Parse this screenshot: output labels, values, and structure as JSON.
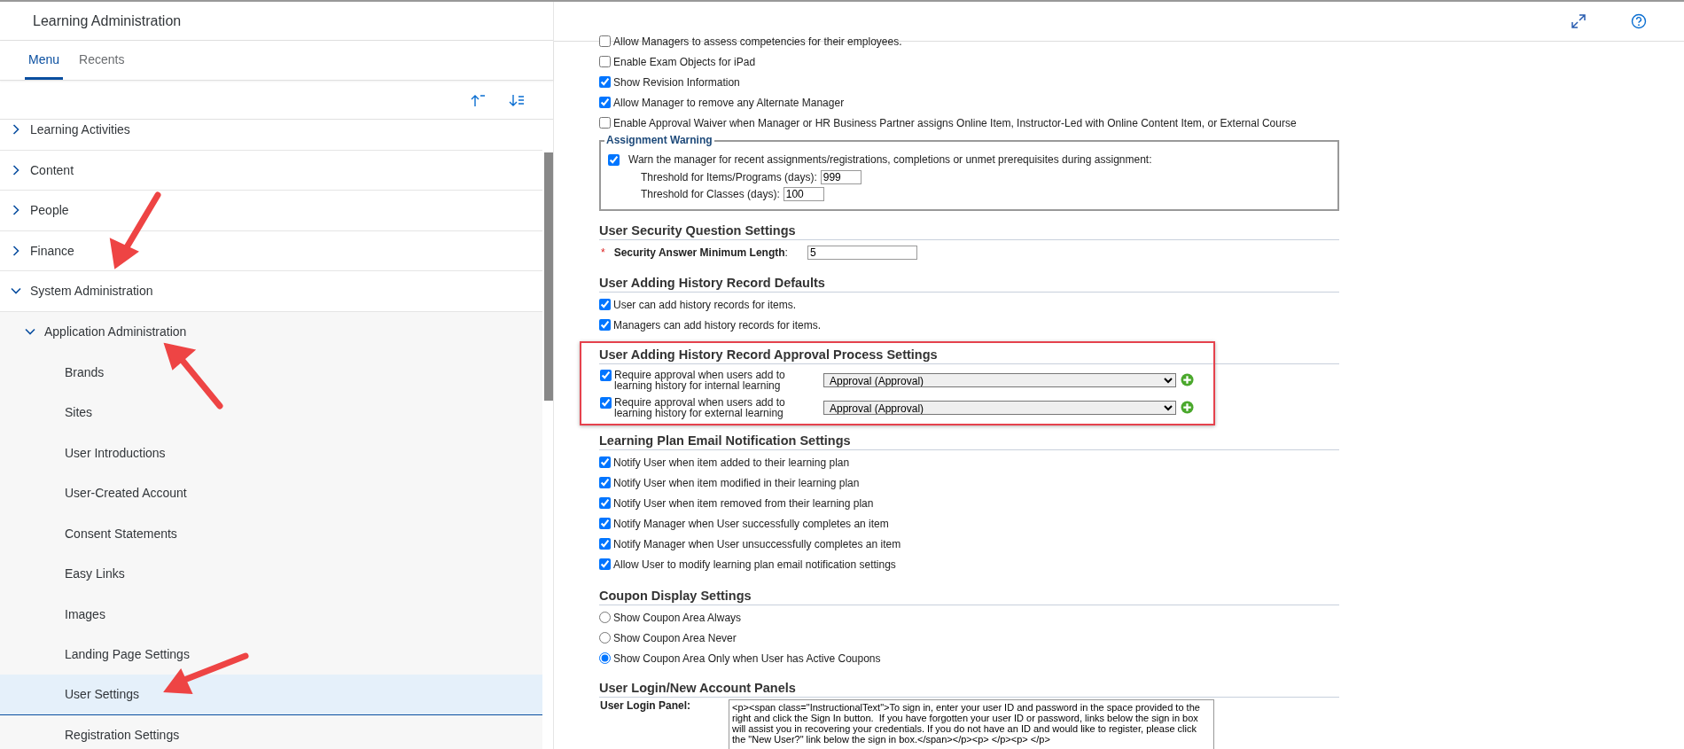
{
  "app_title": "Learning Administration",
  "tabs": [
    {
      "label": "Menu",
      "selected": true
    },
    {
      "label": "Recents",
      "selected": false
    }
  ],
  "menu": [
    {
      "label": "Learning Activities",
      "expanded": false,
      "selected": false
    },
    {
      "label": "Content",
      "expanded": false,
      "selected": false
    },
    {
      "label": "People",
      "expanded": false,
      "selected": false
    },
    {
      "label": "Finance",
      "expanded": false,
      "selected": false
    },
    {
      "label": "System Administration",
      "expanded": true,
      "selected": false,
      "children": [
        {
          "label": "Application Administration",
          "expanded": true,
          "selected": false,
          "children": [
            {
              "label": "Brands",
              "selected": false
            },
            {
              "label": "Sites",
              "selected": false
            },
            {
              "label": "User Introductions",
              "selected": false
            },
            {
              "label": "User-Created Account",
              "selected": false
            },
            {
              "label": "Consent Statements",
              "selected": false
            },
            {
              "label": "Easy Links",
              "selected": false
            },
            {
              "label": "Images",
              "selected": false
            },
            {
              "label": "Landing Page Settings",
              "selected": false
            },
            {
              "label": "User Settings",
              "selected": true
            },
            {
              "label": "Registration Settings",
              "selected": false
            }
          ]
        }
      ]
    }
  ],
  "sections": [
    {
      "kind": "checkboxes",
      "items": [
        {
          "label": "Allow Managers to assess competencies for their employees.",
          "checked": false
        },
        {
          "label": "Enable Exam Objects for iPad",
          "checked": false
        },
        {
          "label": "Show Revision Information",
          "checked": true
        },
        {
          "label": "Allow Manager to remove any Alternate Manager",
          "checked": true
        },
        {
          "label": "Enable Approval Waiver when Manager or HR Business Partner assigns Online Item, Instructor-Led with Online Content Item, or External Course",
          "checked": false
        }
      ]
    },
    {
      "kind": "fieldset",
      "title": "Assignment Warning",
      "checkbox": {
        "label": "Warn the manager for recent assignments/registrations, completions or unmet prerequisites during assignment:",
        "checked": true
      },
      "fields": [
        {
          "label": "Threshold for Items/Programs (days):",
          "value": "999"
        },
        {
          "label": "Threshold for Classes (days):",
          "value": "100"
        }
      ]
    },
    {
      "kind": "fields",
      "title": "User Security Question Settings",
      "items": [
        {
          "required_mark": "*",
          "label": "**Security Answer Minimum Length**:",
          "value": "5"
        }
      ]
    },
    {
      "kind": "checkboxes",
      "title": "User Adding History Record Defaults",
      "items": [
        {
          "label": "User can add history records for items.",
          "checked": true
        },
        {
          "label": "Managers can add history records for items.",
          "checked": true
        }
      ]
    },
    {
      "kind": "approvals",
      "title": "User Adding History Record Approval Process Settings",
      "highlighted": true,
      "items": [
        {
          "label": "Require approval when users add to learning history for internal learning",
          "checked": true,
          "value": "Approval (Approval)"
        },
        {
          "label": "Require approval when users add to learning history for external learning",
          "checked": true,
          "value": "Approval (Approval)"
        }
      ]
    },
    {
      "kind": "checkboxes",
      "title": "Learning Plan Email Notification Settings",
      "items": [
        {
          "label": "Notify User when item added to their learning plan",
          "checked": true
        },
        {
          "label": "Notify User when item modified in their learning plan",
          "checked": true
        },
        {
          "label": "Notify User when item removed from their learning plan",
          "checked": true
        },
        {
          "label": "Notify Manager when User successfully completes an item",
          "checked": true
        },
        {
          "label": "Notify Manager when User unsuccessfully completes an item",
          "checked": true
        },
        {
          "label": "Allow User to modify learning plan email notification settings",
          "checked": true
        }
      ]
    },
    {
      "kind": "radios",
      "title": "Coupon Display Settings",
      "items": [
        {
          "label": "Show Coupon Area Always",
          "selected": false
        },
        {
          "label": "Show Coupon Area Never",
          "selected": false
        },
        {
          "label": "Show Coupon Area Only when User has Active Coupons",
          "selected": true
        }
      ]
    },
    {
      "kind": "panel",
      "title": "User Login/New Account Panels",
      "items": [
        {
          "label": "User Login Panel:",
          "value": "<p><span class=\"InstructionalText\">To sign in, enter your user ID and password in the space provided to the right and click the Sign In button.  If you have forgotten your user ID or password, links below the sign in box will assist you in recovering your credentials. If you do not have an ID and would like to register, please click the \"New User?\" link below the sign in box.</span></p><p> </p><p> </p>"
        }
      ]
    }
  ]
}
